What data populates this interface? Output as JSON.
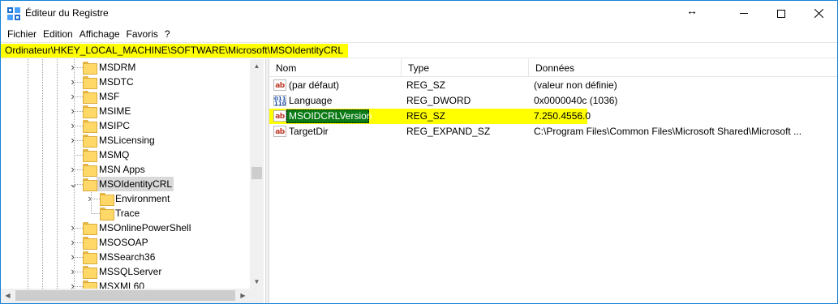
{
  "window": {
    "title": "Éditeur du Registre",
    "resize_glyph": "↔"
  },
  "menu": [
    "Fichier",
    "Edition",
    "Affichage",
    "Favoris",
    "?"
  ],
  "address": {
    "path": "Ordinateur\\HKEY_LOCAL_MACHINE\\SOFTWARE\\Microsoft\\MSOIdentityCRL",
    "highlight_color": "#ffff00"
  },
  "tree": {
    "items": [
      {
        "label": "MSDRM",
        "level": 1,
        "expander": ">"
      },
      {
        "label": "MSDTC",
        "level": 1,
        "expander": ">"
      },
      {
        "label": "MSF",
        "level": 1,
        "expander": ">"
      },
      {
        "label": "MSIME",
        "level": 1,
        "expander": ">"
      },
      {
        "label": "MSIPC",
        "level": 1,
        "expander": ">"
      },
      {
        "label": "MSLicensing",
        "level": 1,
        "expander": ">"
      },
      {
        "label": "MSMQ",
        "level": 1,
        "expander": ""
      },
      {
        "label": "MSN Apps",
        "level": 1,
        "expander": ">"
      },
      {
        "label": "MSOIdentityCRL",
        "level": 1,
        "expander": "v",
        "selected": true
      },
      {
        "label": "Environment",
        "level": 2,
        "expander": ">"
      },
      {
        "label": "Trace",
        "level": 2,
        "expander": ""
      },
      {
        "label": "MSOnlinePowerShell",
        "level": 1,
        "expander": ">"
      },
      {
        "label": "MSOSOAP",
        "level": 1,
        "expander": ">"
      },
      {
        "label": "MSSearch36",
        "level": 1,
        "expander": ">"
      },
      {
        "label": "MSSQLServer",
        "level": 1,
        "expander": ">"
      },
      {
        "label": "MSXML60",
        "level": 1,
        "expander": ">"
      }
    ]
  },
  "list": {
    "columns": [
      "Nom",
      "Type",
      "Données"
    ],
    "rows": [
      {
        "icon": "string-value-icon",
        "glyph": "ab",
        "name": "(par défaut)",
        "type": "REG_SZ",
        "data": "(valeur non définie)"
      },
      {
        "icon": "dword-value-icon",
        "glyph": "011\n110",
        "name": "Language",
        "type": "REG_DWORD",
        "data": "0x0000040c (1036)"
      },
      {
        "icon": "string-value-icon",
        "glyph": "ab",
        "name": "MSOIDCRLVersion",
        "type": "REG_SZ",
        "data": "7.250.4556.0",
        "highlighted": true
      },
      {
        "icon": "string-value-icon",
        "glyph": "ab",
        "name": "TargetDir",
        "type": "REG_EXPAND_SZ",
        "data": "C:\\Program Files\\Common Files\\Microsoft Shared\\Microsoft ..."
      }
    ],
    "highlight_color": "#ffff00",
    "selection_color": "#0a7a15"
  }
}
